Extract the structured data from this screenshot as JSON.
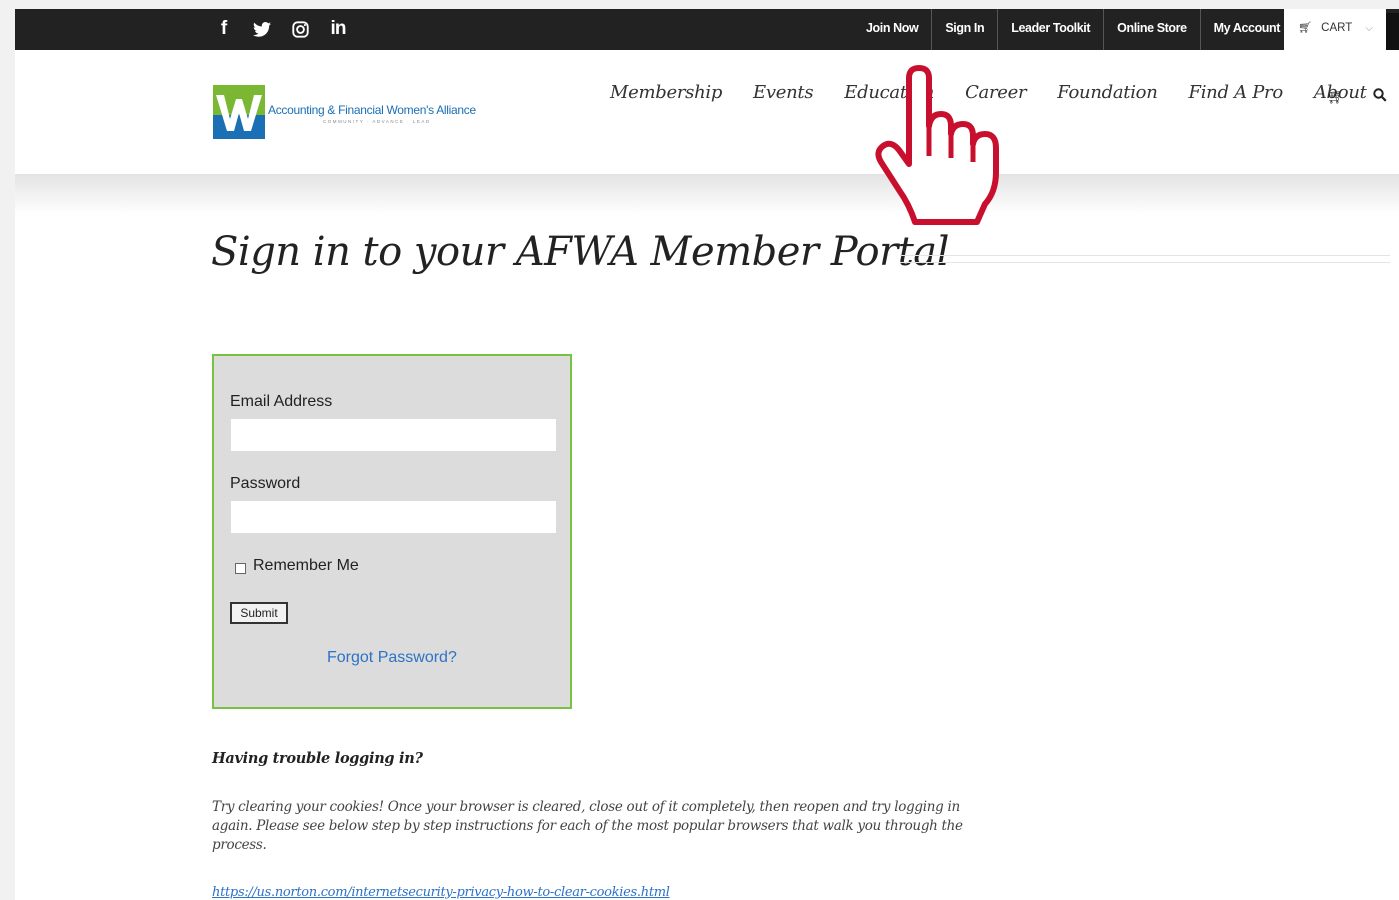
{
  "social": {
    "facebook_icon": "f",
    "twitter_icon": "twitter-bird",
    "instagram_icon": "instagram-camera",
    "linkedin_icon": "in"
  },
  "top_links": [
    "Join Now",
    "Sign In",
    "Leader Toolkit",
    "Online Store",
    "My Account"
  ],
  "cart": {
    "label": "CART",
    "icon": "cart-icon"
  },
  "logo": {
    "name": "Accounting & Financial Women's Alliance",
    "tagline": "COMMUNITY · ADVANCE · LEAD",
    "colors": {
      "green": "#7ab733",
      "blue": "#1a6fb5"
    }
  },
  "nav": {
    "items": [
      "Membership",
      "Events",
      "Education",
      "Career",
      "Foundation",
      "Find A Pro",
      "About"
    ],
    "cart_icon": "cart-icon",
    "search_icon": "search-icon"
  },
  "page_title": "Sign in to your AFWA Member Portal",
  "login": {
    "email_label": "Email Address",
    "email_value": "",
    "password_label": "Password",
    "password_value": "",
    "remember_label": "Remember Me",
    "submit_label": "Submit",
    "forgot_label": "Forgot Password?",
    "border_color": "#79c143"
  },
  "help": {
    "heading": "Having trouble logging in?",
    "text": "Try clearing your cookies! Once your browser is cleared, close out of it completely, then reopen and try logging in again. Please see below step by step instructions for each of the most popular browsers that walk you through the process.",
    "link": "https://us.norton.com/internetsecurity-privacy-how-to-clear-cookies.html"
  },
  "cursor": {
    "icon": "hand-pointer-icon",
    "color": "#c8102e"
  }
}
